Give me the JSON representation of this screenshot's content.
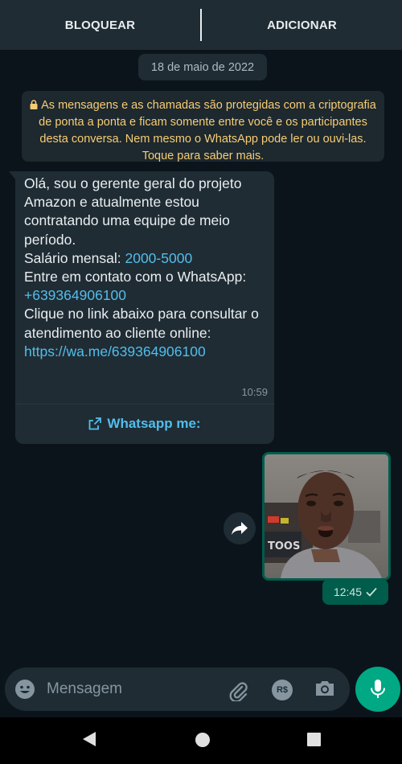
{
  "header": {
    "block_label": "BLOQUEAR",
    "add_label": "ADICIONAR"
  },
  "chat": {
    "date": "18 de maio de 2022",
    "encryption_notice": "As mensagens e as chamadas são protegidas com a criptografia de ponta a ponta e ficam somente entre você e os participantes desta conversa. Nem mesmo o WhatsApp pode ler ou ouvi-las. Toque para saber mais.",
    "incoming": {
      "line1": "Olá, sou o gerente geral do projeto Amazon e atualmente estou contratando uma equipe de meio período.",
      "salary_label": "Salário mensal: ",
      "salary_value": "2000-5000",
      "contact_label": "Entre em contato com o WhatsApp: ",
      "contact_phone": "+639364906100",
      "click_text": "Clique no link abaixo para consultar o atendimento ao cliente online:",
      "link": "https://wa.me/639364906100",
      "time": "10:59",
      "button_label": "Whatsapp me:"
    },
    "outgoing_image": {
      "time": "12:45",
      "status": "sent-check-icon"
    }
  },
  "composer": {
    "placeholder": "Mensagem",
    "pay_label": "R$"
  },
  "icons": {
    "emoji": "emoji-icon",
    "attach": "paperclip-icon",
    "camera": "camera-icon",
    "mic": "microphone-icon",
    "forward": "forward-icon",
    "lock": "lock-icon"
  },
  "colors": {
    "background": "#0b141a",
    "bubble_in": "#1f2c34",
    "bubble_out": "#005c4b",
    "accent": "#00a884",
    "link": "#53bdeb",
    "notice_text": "#f7cd73"
  }
}
